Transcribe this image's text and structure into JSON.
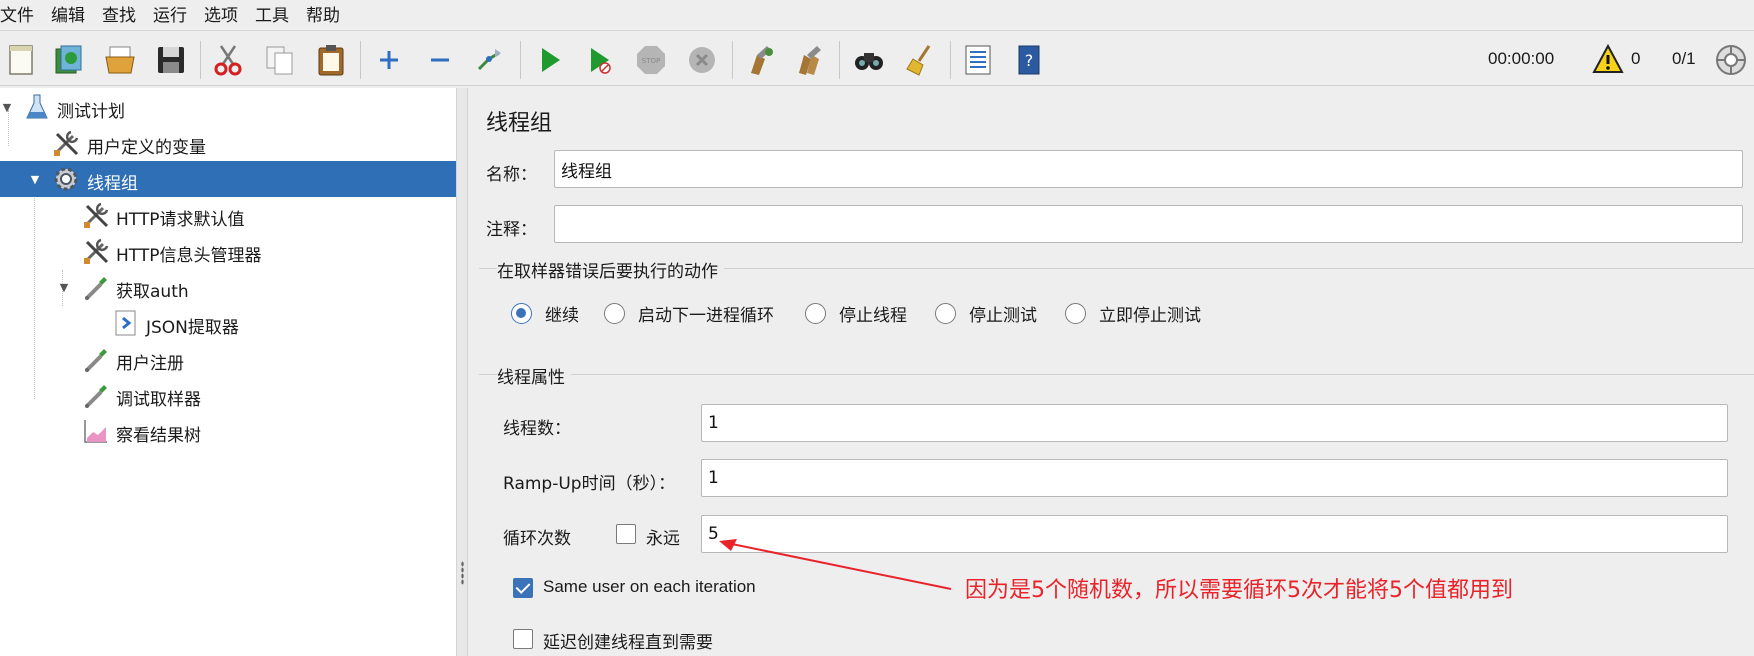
{
  "menu": [
    "文件",
    "编辑",
    "查找",
    "运行",
    "选项",
    "工具",
    "帮助"
  ],
  "toolbar": {
    "buttons": [
      {
        "name": "new-plan-icon"
      },
      {
        "name": "templates-icon"
      },
      {
        "name": "open-icon"
      },
      {
        "name": "save-icon"
      },
      {
        "name": "cut-icon"
      },
      {
        "name": "copy-icon"
      },
      {
        "name": "paste-icon"
      },
      {
        "name": "expand-icon"
      },
      {
        "name": "collapse-icon"
      },
      {
        "name": "toggle-icon"
      },
      {
        "name": "start-icon"
      },
      {
        "name": "start-no-pause-icon"
      },
      {
        "name": "stop-icon"
      },
      {
        "name": "shutdown-icon"
      },
      {
        "name": "clear-icon"
      },
      {
        "name": "clear-all-icon"
      },
      {
        "name": "search-icon"
      },
      {
        "name": "reset-search-icon"
      },
      {
        "name": "function-helper-icon"
      },
      {
        "name": "help-icon"
      }
    ],
    "timer": "00:00:00",
    "warnings": "0",
    "threads": "0/1"
  },
  "tree": [
    {
      "label": "测试计划",
      "icon": "flask-icon"
    },
    {
      "label": "用户定义的变量",
      "icon": "tools-icon"
    },
    {
      "label": "线程组",
      "icon": "gear-icon",
      "selected": true
    },
    {
      "label": "HTTP请求默认值",
      "icon": "tools-icon"
    },
    {
      "label": "HTTP信息头管理器",
      "icon": "tools-icon"
    },
    {
      "label": "获取auth",
      "icon": "pipette-icon"
    },
    {
      "label": "JSON提取器",
      "icon": "extractor-icon"
    },
    {
      "label": "用户注册",
      "icon": "pipette-icon"
    },
    {
      "label": "调试取样器",
      "icon": "pipette-icon"
    },
    {
      "label": "察看结果树",
      "icon": "chart-icon"
    }
  ],
  "panel": {
    "title": "线程组",
    "name_label": "名称：",
    "name_value": "线程组",
    "comment_label": "注释：",
    "comment_value": "",
    "error_group_title": "在取样器错误后要执行的动作",
    "error_options": [
      "继续",
      "启动下一进程循环",
      "停止线程",
      "停止测试",
      "立即停止测试"
    ],
    "error_selected": "继续",
    "props_group_title": "线程属性",
    "threads_label": "线程数：",
    "threads_value": "1",
    "rampup_label": "Ramp-Up时间（秒）：",
    "rampup_value": "1",
    "loop_label": "循环次数",
    "forever_label": "永远",
    "forever_checked": false,
    "loop_value": "5",
    "same_user_label": "Same user on each iteration",
    "same_user_checked": true,
    "delay_label": "延迟创建线程直到需要",
    "delay_checked": false
  },
  "annotation": {
    "text": "因为是5个随机数，所以需要循环5次才能将5个值都用到",
    "color": "#e8232a"
  }
}
